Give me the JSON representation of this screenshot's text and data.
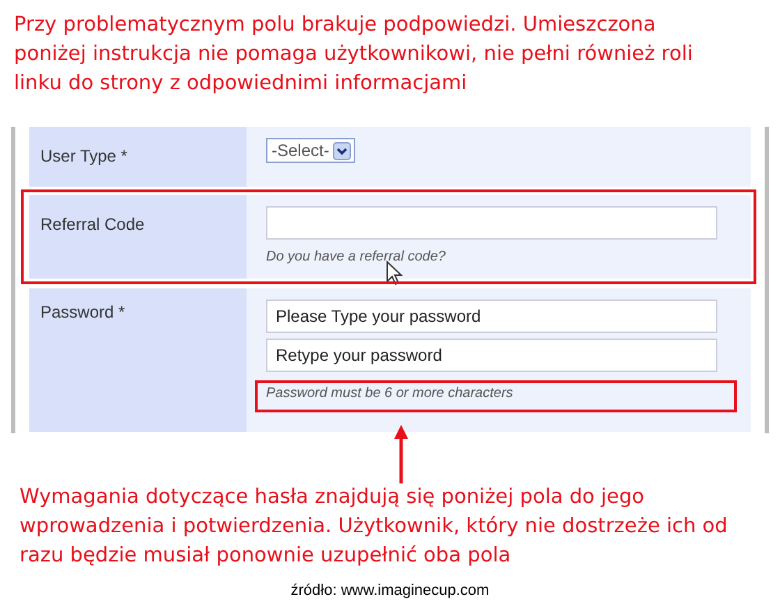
{
  "top_note": "Przy problematycznym polu brakuje podpowiedzi. Umieszczona poniżej instrukcja nie pomaga użytkownikowi, nie pełni również roli linku do strony z odpowiednimi informacjami",
  "form": {
    "rows": [
      {
        "label": "User Type *",
        "kind": "select",
        "value": "-Select-",
        "highlighted": false
      },
      {
        "label": "Referral Code",
        "kind": "text",
        "hint": "Do you have a referral code?",
        "highlighted": true,
        "cursor": true
      },
      {
        "label": "Password *",
        "kind": "password",
        "fields": [
          {
            "placeholder": "Please Type your password"
          },
          {
            "placeholder": "Retype your password"
          }
        ],
        "hint": "Password must be 6 or more characters",
        "hint_highlighted": true
      }
    ]
  },
  "bottom_note": "Wymagania dotyczące hasła znajdują się poniżej pola do jego wprowadzenia i potwierdzenia. Użytkownik, który nie dostrzeże ich od razu będzie musiał ponownie uzupełnić oba pola",
  "source": "źródło: www.imaginecup.com"
}
